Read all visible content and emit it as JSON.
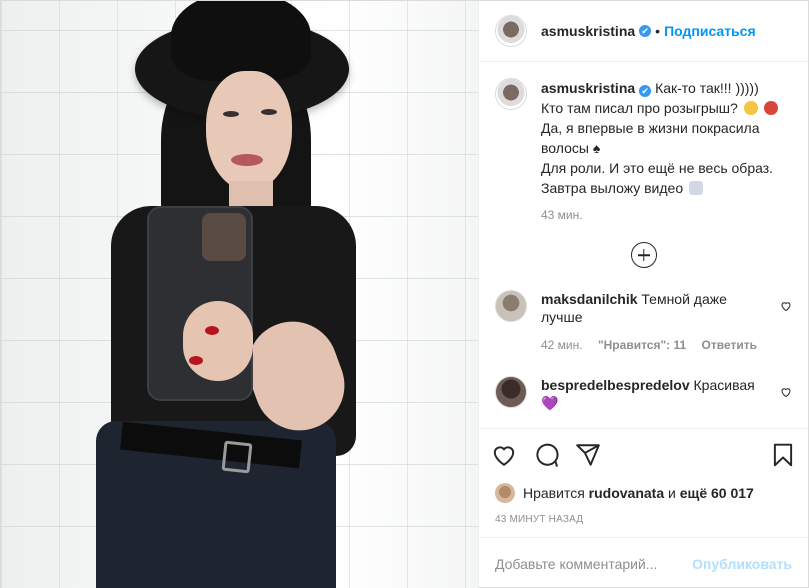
{
  "header": {
    "username": "asmuskristina",
    "verified_mark": "✔",
    "separator": "•",
    "follow_label": "Подписаться"
  },
  "caption": {
    "username": "asmuskristina",
    "verified_mark": "✔",
    "lines": [
      "Как-то так!!! )))))",
      "Кто там писал про розыгрыш?",
      "Да, я впервые в жизни покрасила",
      "волосы ♠",
      "Для роли. И это ещё не весь образ.",
      "Завтра выложу видео"
    ],
    "time": "43 мин."
  },
  "comments": [
    {
      "username": "maksdanilchik",
      "text": "Темной даже лучше",
      "time": "42 мин.",
      "likes_label": "\"Нравится\": 11",
      "reply_label": "Ответить"
    },
    {
      "username": "bespredelbespredelov",
      "text": "Красивая",
      "emoji": "💜"
    }
  ],
  "likes": {
    "prefix": "Нравится",
    "user": "rudovanata",
    "suffix": "и",
    "rest": "ещё 60 017"
  },
  "timestamp": "43 МИНУТ НАЗАД",
  "add_comment": {
    "placeholder": "Добавьте комментарий...",
    "publish_label": "Опубликовать"
  },
  "colors": {
    "link": "#0095f6",
    "verified": "#3897f0",
    "muted": "#8e8e8e",
    "publish_disabled": "#b2dffc"
  }
}
